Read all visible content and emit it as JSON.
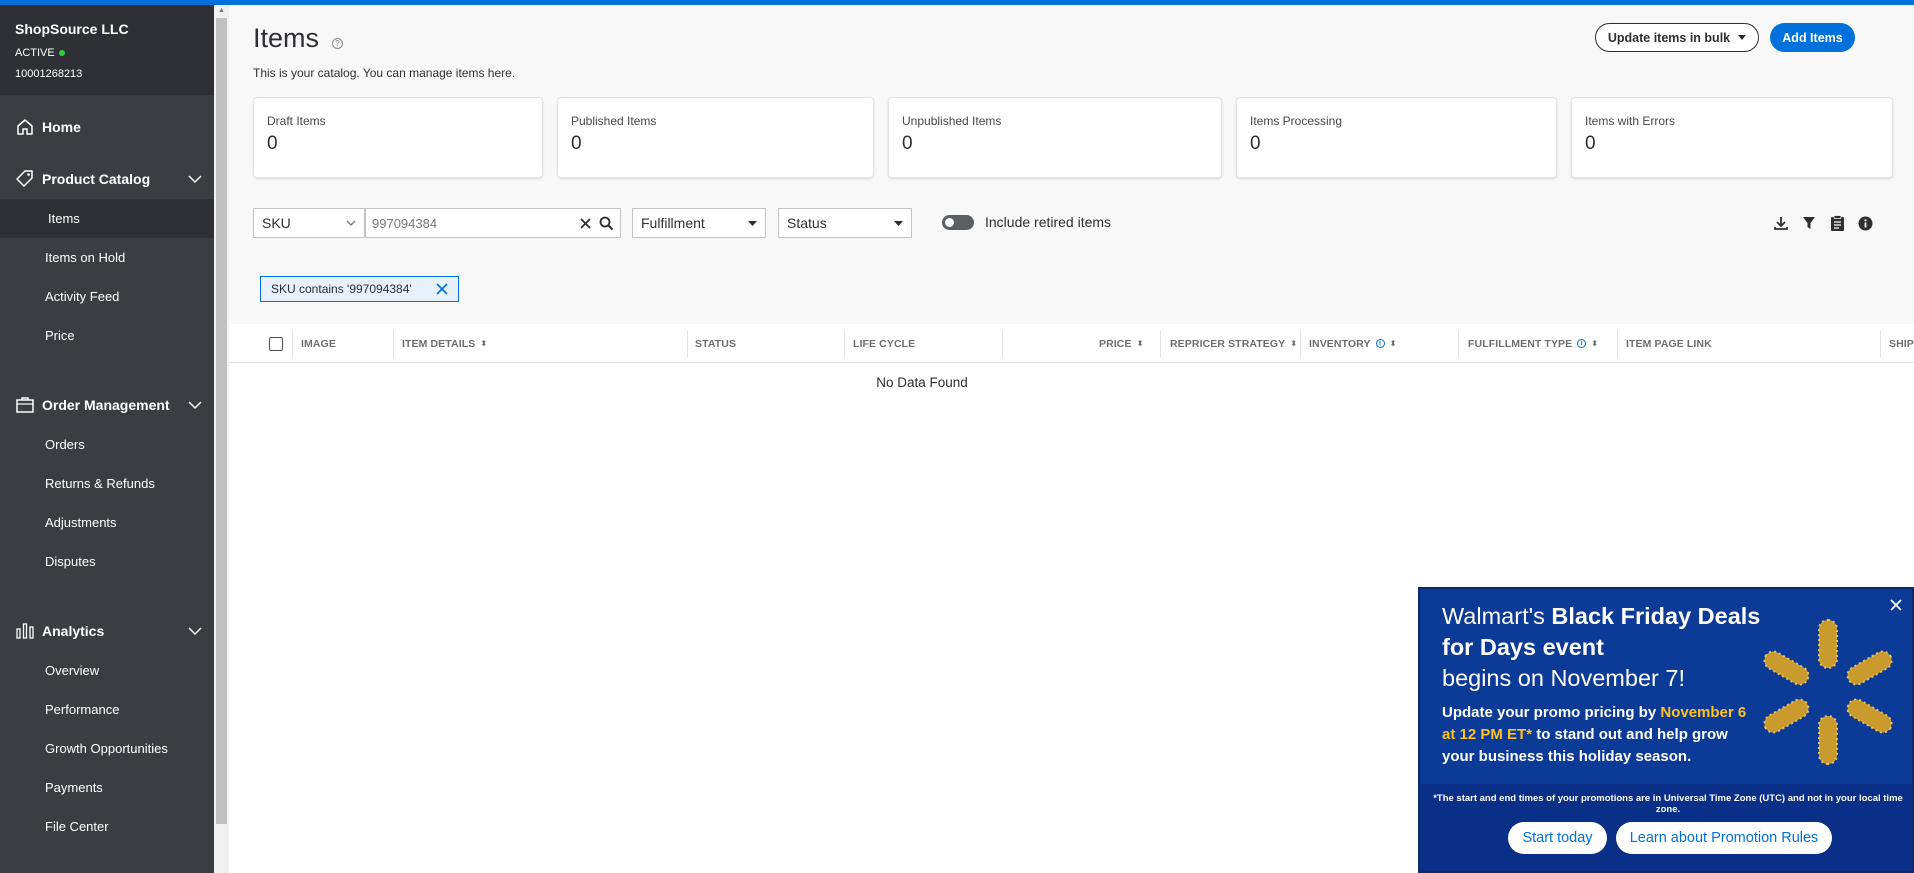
{
  "sidebar": {
    "org_name": "ShopSource LLC",
    "org_status": "ACTIVE",
    "org_id": "10001268213",
    "home": "Home",
    "product_catalog": {
      "label": "Product Catalog",
      "items": [
        "Items",
        "Items on Hold",
        "Activity Feed",
        "Price"
      ]
    },
    "order_management": {
      "label": "Order Management",
      "items": [
        "Orders",
        "Returns & Refunds",
        "Adjustments",
        "Disputes"
      ]
    },
    "analytics": {
      "label": "Analytics",
      "items": [
        "Overview",
        "Performance",
        "Growth Opportunities",
        "Payments",
        "File Center"
      ]
    }
  },
  "header": {
    "title": "Items",
    "subtitle": "This is your catalog. You can manage items here.",
    "bulk_button": "Update items in bulk",
    "add_button": "Add Items"
  },
  "stats": [
    {
      "label": "Draft Items",
      "value": "0"
    },
    {
      "label": "Published Items",
      "value": "0"
    },
    {
      "label": "Unpublished Items",
      "value": "0"
    },
    {
      "label": "Items Processing",
      "value": "0"
    },
    {
      "label": "Items with Errors",
      "value": "0"
    }
  ],
  "filters": {
    "search_type": "SKU",
    "search_value": "997094384",
    "fulfillment": "Fulfillment",
    "status": "Status",
    "include_retired": "Include retired items"
  },
  "active_filter_chip": "SKU contains '997094384'",
  "table": {
    "columns": [
      "IMAGE",
      "ITEM DETAILS",
      "STATUS",
      "LIFE CYCLE",
      "PRICE",
      "REPRICER STRATEGY",
      "INVENTORY",
      "FULFILLMENT TYPE",
      "ITEM PAGE LINK",
      "SHIPP"
    ],
    "empty_text": "No Data Found"
  },
  "promo": {
    "head_a": "Walmart's ",
    "head_b": "Black Friday Deals for Days event",
    "head_c": "begins on November 7!",
    "body_a": "Update your promo pricing by ",
    "body_hl": "November 6 at 12 PM ET*",
    "body_b": " to stand out and help grow your business this holiday season.",
    "note": "*The start and end times of your promotions are in Universal Time Zone (UTC) and not in your local time zone.",
    "btn_start": "Start today",
    "btn_learn": "Learn about Promotion Rules"
  },
  "colors": {
    "brand_blue": "#0071dc",
    "sidebar_bg": "#3a3d42",
    "promo_bg": "#0b3a97",
    "promo_highlight": "#ffc220",
    "status_active": "#2ecc40"
  }
}
